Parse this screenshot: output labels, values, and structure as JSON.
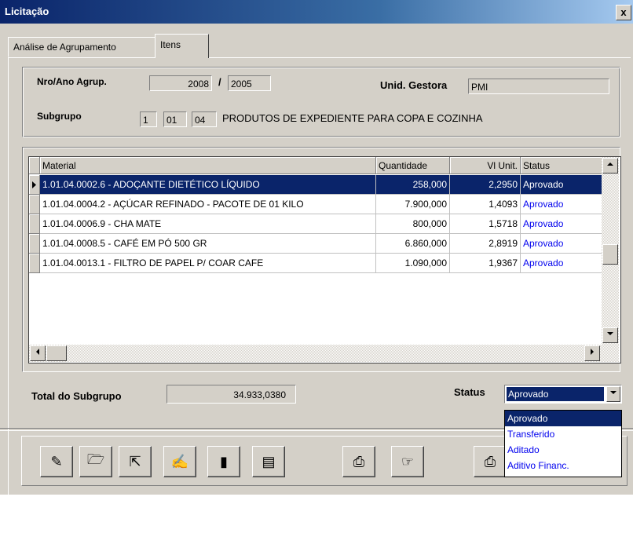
{
  "window": {
    "title": "Licitação",
    "close": "x"
  },
  "tabs": [
    {
      "label": "Análise de Agrupamento"
    },
    {
      "label": "Itens"
    }
  ],
  "header": {
    "nro_ano_label": "Nro/Ano Agrup.",
    "nro_value": "2008",
    "slash": "/",
    "ano_value": "2005",
    "unid_label": "Unid. Gestora",
    "unid_value": "PMI",
    "subgrupo_label": "Subgrupo",
    "sub1": "1",
    "sub2": "01",
    "sub3": "04",
    "subgrupo_desc": "PRODUTOS DE EXPEDIENTE PARA COPA E COZINHA"
  },
  "grid": {
    "columns": [
      "Material",
      "Quantidade",
      "Vl Unit.",
      "Status"
    ],
    "rows": [
      {
        "material": "1.01.04.0002.6 - ADOÇANTE DIETÉTICO LÍQUIDO",
        "quantidade": "258,000",
        "vl_unit": "2,2950",
        "status": "Aprovado"
      },
      {
        "material": "1.01.04.0004.2 - AÇÚCAR REFINADO - PACOTE DE 01 KILO",
        "quantidade": "7.900,000",
        "vl_unit": "1,4093",
        "status": "Aprovado"
      },
      {
        "material": "1.01.04.0006.9 - CHA MATE",
        "quantidade": "800,000",
        "vl_unit": "1,5718",
        "status": "Aprovado"
      },
      {
        "material": "1.01.04.0008.5 - CAFÉ EM PÓ 500 GR",
        "quantidade": "6.860,000",
        "vl_unit": "2,8919",
        "status": "Aprovado"
      },
      {
        "material": "1.01.04.0013.1 - FILTRO DE PAPEL P/ COAR CAFE",
        "quantidade": "1.090,000",
        "vl_unit": "1,9367",
        "status": "Aprovado"
      }
    ]
  },
  "total": {
    "label": "Total do Subgrupo",
    "value": "34.933,0380"
  },
  "status": {
    "label": "Status",
    "selected": "Aprovado",
    "options": [
      "Aprovado",
      "Transferido",
      "Aditado",
      "Aditivo Financ."
    ]
  },
  "toolbar": {
    "icons": [
      "edit-icon",
      "open-folder-icon",
      "export-icon",
      "notes-icon",
      "chart-icon",
      "clipboard-icon",
      "print-preview-icon",
      "pointer-icon",
      "print-icon"
    ]
  },
  "colors": {
    "selection": "#0a246a",
    "link_text": "#0000ee",
    "face": "#d4d0c8"
  }
}
